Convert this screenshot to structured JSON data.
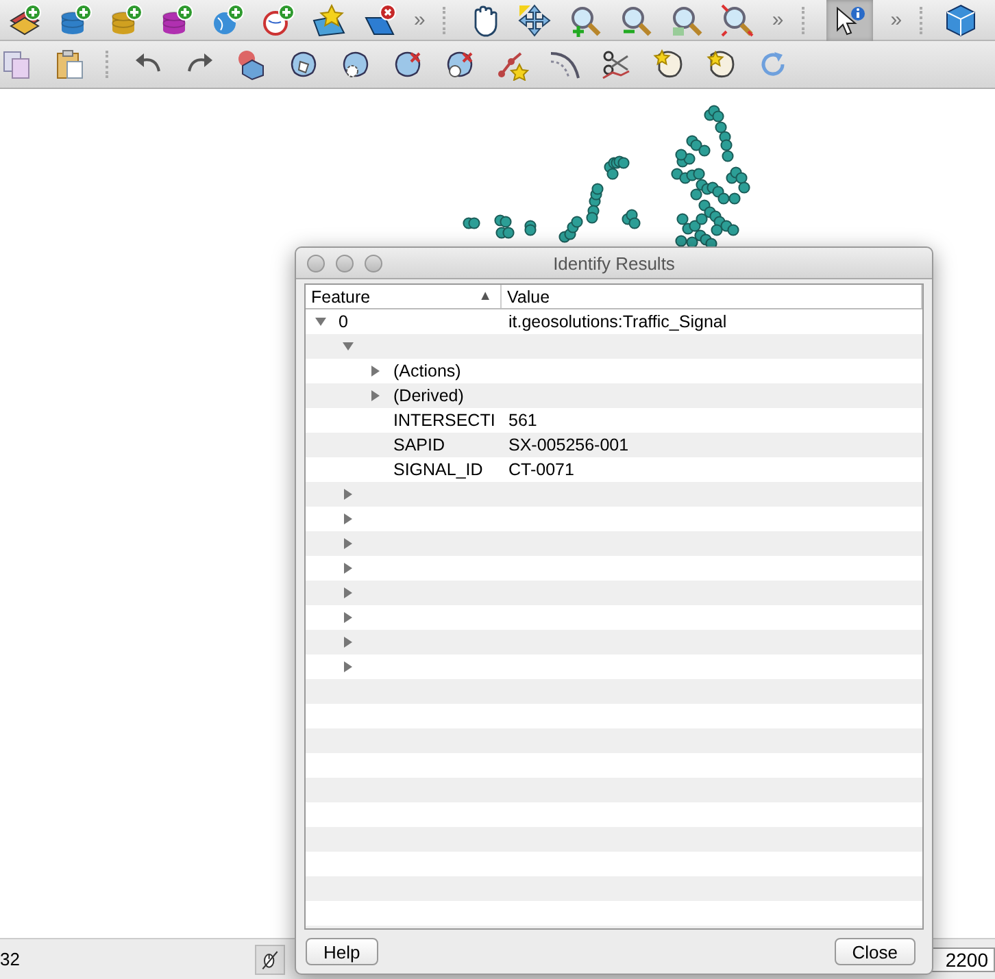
{
  "toolbar": {
    "overflow_marks": [
      "»",
      "»",
      "»"
    ],
    "identify_tool_selected": true
  },
  "status_bar": {
    "coordinate": "32",
    "scale": "2200"
  },
  "dialog": {
    "title": "Identify Results",
    "columns": [
      {
        "label": "Feature",
        "sort_mark": "▲"
      },
      {
        "label": "Value"
      }
    ],
    "rows": [
      {
        "feature": "0",
        "value": "it.geosolutions:Traffic_Signal",
        "expanded": true,
        "children": [
          {
            "expanded": true,
            "children": [
              {
                "feature": "(Actions)",
                "expanded": false
              },
              {
                "feature": "(Derived)",
                "expanded": false
              },
              {
                "feature": "INTERSECTI",
                "value": "561"
              },
              {
                "feature": "SAPID",
                "value": "SX-005256-001"
              },
              {
                "feature": "SIGNAL_ID",
                "value": "CT-0071"
              }
            ]
          },
          {
            "expanded": false
          },
          {
            "expanded": false
          },
          {
            "expanded": false
          },
          {
            "expanded": false
          },
          {
            "expanded": false
          },
          {
            "expanded": false
          },
          {
            "expanded": false
          },
          {
            "expanded": false
          }
        ]
      }
    ],
    "buttons": [
      {
        "label": "Help"
      },
      {
        "label": "Close"
      }
    ]
  }
}
